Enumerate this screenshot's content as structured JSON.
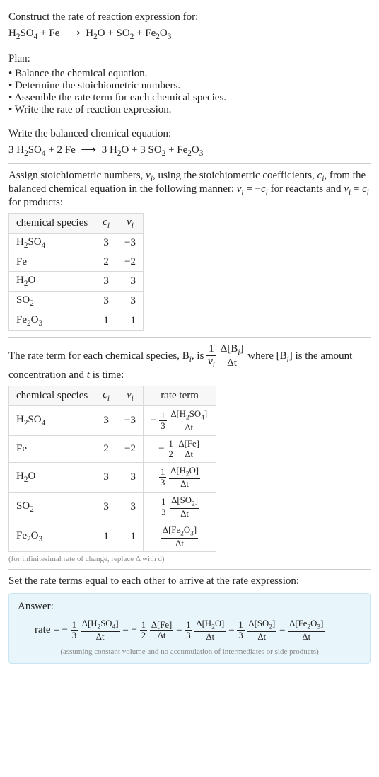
{
  "header": {
    "prompt": "Construct the rate of reaction expression for:",
    "eq_lhs_1": "H",
    "eq_lhs_1s": "2",
    "eq_lhs_2": "SO",
    "eq_lhs_2s": "4",
    "eq_plus1": " + Fe ",
    "eq_arrow": "⟶",
    "eq_rhs_1": " H",
    "eq_rhs_1s": "2",
    "eq_rhs_2": "O + SO",
    "eq_rhs_2s": "2",
    "eq_rhs_3": " + Fe",
    "eq_rhs_3s": "2",
    "eq_rhs_4": "O",
    "eq_rhs_4s": "3"
  },
  "plan": {
    "title": "Plan:",
    "items": [
      "Balance the chemical equation.",
      "Determine the stoichiometric numbers.",
      "Assemble the rate term for each chemical species.",
      "Write the rate of reaction expression."
    ]
  },
  "balanced": {
    "intro": "Write the balanced chemical equation:",
    "c1": "3 H",
    "c1s": "2",
    "c2": "SO",
    "c2s": "4",
    "plus1": " + 2 Fe ",
    "arrow": "⟶",
    "c3": " 3 H",
    "c3s": "2",
    "c4": "O + 3 SO",
    "c4s": "2",
    "c5": " + Fe",
    "c5s": "2",
    "c6": "O",
    "c6s": "3"
  },
  "stoich": {
    "text1": "Assign stoichiometric numbers, ",
    "vi": "ν",
    "vi_sub": "i",
    "text2": ", using the stoichiometric coefficients, ",
    "ci": "c",
    "ci_sub": "i",
    "text3": ", from the balanced chemical equation in the following manner: ",
    "rel1": "ν",
    "rel1_sub": "i",
    "rel_eq": " = −",
    "rel2": "c",
    "rel2_sub": "i",
    "text4": " for reactants and ",
    "rel3": "ν",
    "rel3_sub": "i",
    "rel_eq2": " = ",
    "rel4": "c",
    "rel4_sub": "i",
    "text5": " for products:",
    "headers": {
      "species": "chemical species",
      "ci": "c",
      "ci_sub": "i",
      "vi": "ν",
      "vi_sub": "i"
    },
    "rows": [
      {
        "sp_a": "H",
        "sp_as": "2",
        "sp_b": "SO",
        "sp_bs": "4",
        "ci": "3",
        "vi": "−3"
      },
      {
        "sp_a": "Fe",
        "sp_as": "",
        "sp_b": "",
        "sp_bs": "",
        "ci": "2",
        "vi": "−2"
      },
      {
        "sp_a": "H",
        "sp_as": "2",
        "sp_b": "O",
        "sp_bs": "",
        "ci": "3",
        "vi": "3"
      },
      {
        "sp_a": "SO",
        "sp_as": "2",
        "sp_b": "",
        "sp_bs": "",
        "ci": "3",
        "vi": "3"
      },
      {
        "sp_a": "Fe",
        "sp_as": "2",
        "sp_b": "O",
        "sp_bs": "3",
        "ci": "1",
        "vi": "1"
      }
    ]
  },
  "rateterm": {
    "t1": "The rate term for each chemical species, B",
    "t1_sub": "i",
    "t2": ", is ",
    "f1_num": "1",
    "f1_den_a": "ν",
    "f1_den_sub": "i",
    "f2_num_a": "Δ[B",
    "f2_num_sub": "i",
    "f2_num_b": "]",
    "f2_den": "Δt",
    "t3": " where [B",
    "t3_sub": "i",
    "t4": "] is the amount concentration and ",
    "t5": "t",
    "t6": " is time:",
    "headers": {
      "species": "chemical species",
      "ci": "c",
      "ci_sub": "i",
      "vi": "ν",
      "vi_sub": "i",
      "rate": "rate term"
    },
    "rows": [
      {
        "sp_a": "H",
        "sp_as": "2",
        "sp_b": "SO",
        "sp_bs": "4",
        "ci": "3",
        "vi": "−3",
        "sign": "−",
        "cn": "1",
        "cd": "3",
        "bn_a": "Δ[H",
        "bn_as": "2",
        "bn_b": "SO",
        "bn_bs": "4",
        "bn_c": "]",
        "bd": "Δt"
      },
      {
        "sp_a": "Fe",
        "sp_as": "",
        "sp_b": "",
        "sp_bs": "",
        "ci": "2",
        "vi": "−2",
        "sign": "−",
        "cn": "1",
        "cd": "2",
        "bn_a": "Δ[Fe]",
        "bn_as": "",
        "bn_b": "",
        "bn_bs": "",
        "bn_c": "",
        "bd": "Δt"
      },
      {
        "sp_a": "H",
        "sp_as": "2",
        "sp_b": "O",
        "sp_bs": "",
        "ci": "3",
        "vi": "3",
        "sign": "",
        "cn": "1",
        "cd": "3",
        "bn_a": "Δ[H",
        "bn_as": "2",
        "bn_b": "O]",
        "bn_bs": "",
        "bn_c": "",
        "bd": "Δt"
      },
      {
        "sp_a": "SO",
        "sp_as": "2",
        "sp_b": "",
        "sp_bs": "",
        "ci": "3",
        "vi": "3",
        "sign": "",
        "cn": "1",
        "cd": "3",
        "bn_a": "Δ[SO",
        "bn_as": "2",
        "bn_b": "]",
        "bn_bs": "",
        "bn_c": "",
        "bd": "Δt"
      },
      {
        "sp_a": "Fe",
        "sp_as": "2",
        "sp_b": "O",
        "sp_bs": "3",
        "ci": "1",
        "vi": "1",
        "sign": "",
        "cn": "",
        "cd": "",
        "bn_a": "Δ[Fe",
        "bn_as": "2",
        "bn_b": "O",
        "bn_bs": "3",
        "bn_c": "]",
        "bd": "Δt"
      }
    ],
    "footnote": "(for infinitesimal rate of change, replace Δ with d)"
  },
  "final": {
    "intro": "Set the rate terms equal to each other to arrive at the rate expression:",
    "label": "Answer:",
    "rate": "rate = ",
    "terms": [
      {
        "sign": "−",
        "cn": "1",
        "cd": "3",
        "bn_a": "Δ[H",
        "bn_as": "2",
        "bn_b": "SO",
        "bn_bs": "4",
        "bn_c": "]",
        "bd": "Δt"
      },
      {
        "sign": "−",
        "cn": "1",
        "cd": "2",
        "bn_a": "Δ[Fe]",
        "bn_as": "",
        "bn_b": "",
        "bn_bs": "",
        "bn_c": "",
        "bd": "Δt"
      },
      {
        "sign": "",
        "cn": "1",
        "cd": "3",
        "bn_a": "Δ[H",
        "bn_as": "2",
        "bn_b": "O]",
        "bn_bs": "",
        "bn_c": "",
        "bd": "Δt"
      },
      {
        "sign": "",
        "cn": "1",
        "cd": "3",
        "bn_a": "Δ[SO",
        "bn_as": "2",
        "bn_b": "]",
        "bn_bs": "",
        "bn_c": "",
        "bd": "Δt"
      },
      {
        "sign": "",
        "cn": "",
        "cd": "",
        "bn_a": "Δ[Fe",
        "bn_as": "2",
        "bn_b": "O",
        "bn_bs": "3",
        "bn_c": "]",
        "bd": "Δt"
      }
    ],
    "eq": " = ",
    "note": "(assuming constant volume and no accumulation of intermediates or side products)"
  }
}
